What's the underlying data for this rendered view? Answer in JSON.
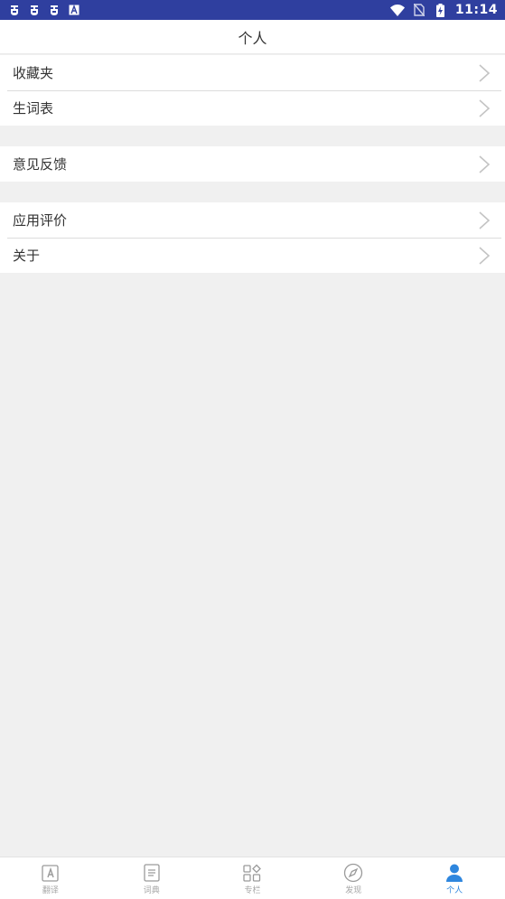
{
  "statusbar": {
    "notification_icons": [
      "bug-icon",
      "bug-icon",
      "bug-icon",
      "a-icon"
    ],
    "time": "11:14"
  },
  "header": {
    "title": "个人"
  },
  "groups": [
    {
      "items": [
        {
          "label": "收藏夹"
        },
        {
          "label": "生词表"
        }
      ]
    },
    {
      "items": [
        {
          "label": "意见反馈"
        }
      ]
    },
    {
      "items": [
        {
          "label": "应用评价"
        },
        {
          "label": "关于"
        }
      ]
    }
  ],
  "bottomnav": {
    "tabs": [
      {
        "label": "翻译",
        "icon": "translate-icon"
      },
      {
        "label": "词典",
        "icon": "dictionary-icon"
      },
      {
        "label": "专栏",
        "icon": "column-grid-icon"
      },
      {
        "label": "发现",
        "icon": "compass-icon"
      },
      {
        "label": "个人",
        "icon": "person-icon",
        "active": true
      }
    ]
  },
  "colors": {
    "statusbar": "#2f3f9f",
    "background": "#f0f0f0",
    "active_tab": "#2e86de",
    "inactive_tab": "#a7a7a7"
  }
}
